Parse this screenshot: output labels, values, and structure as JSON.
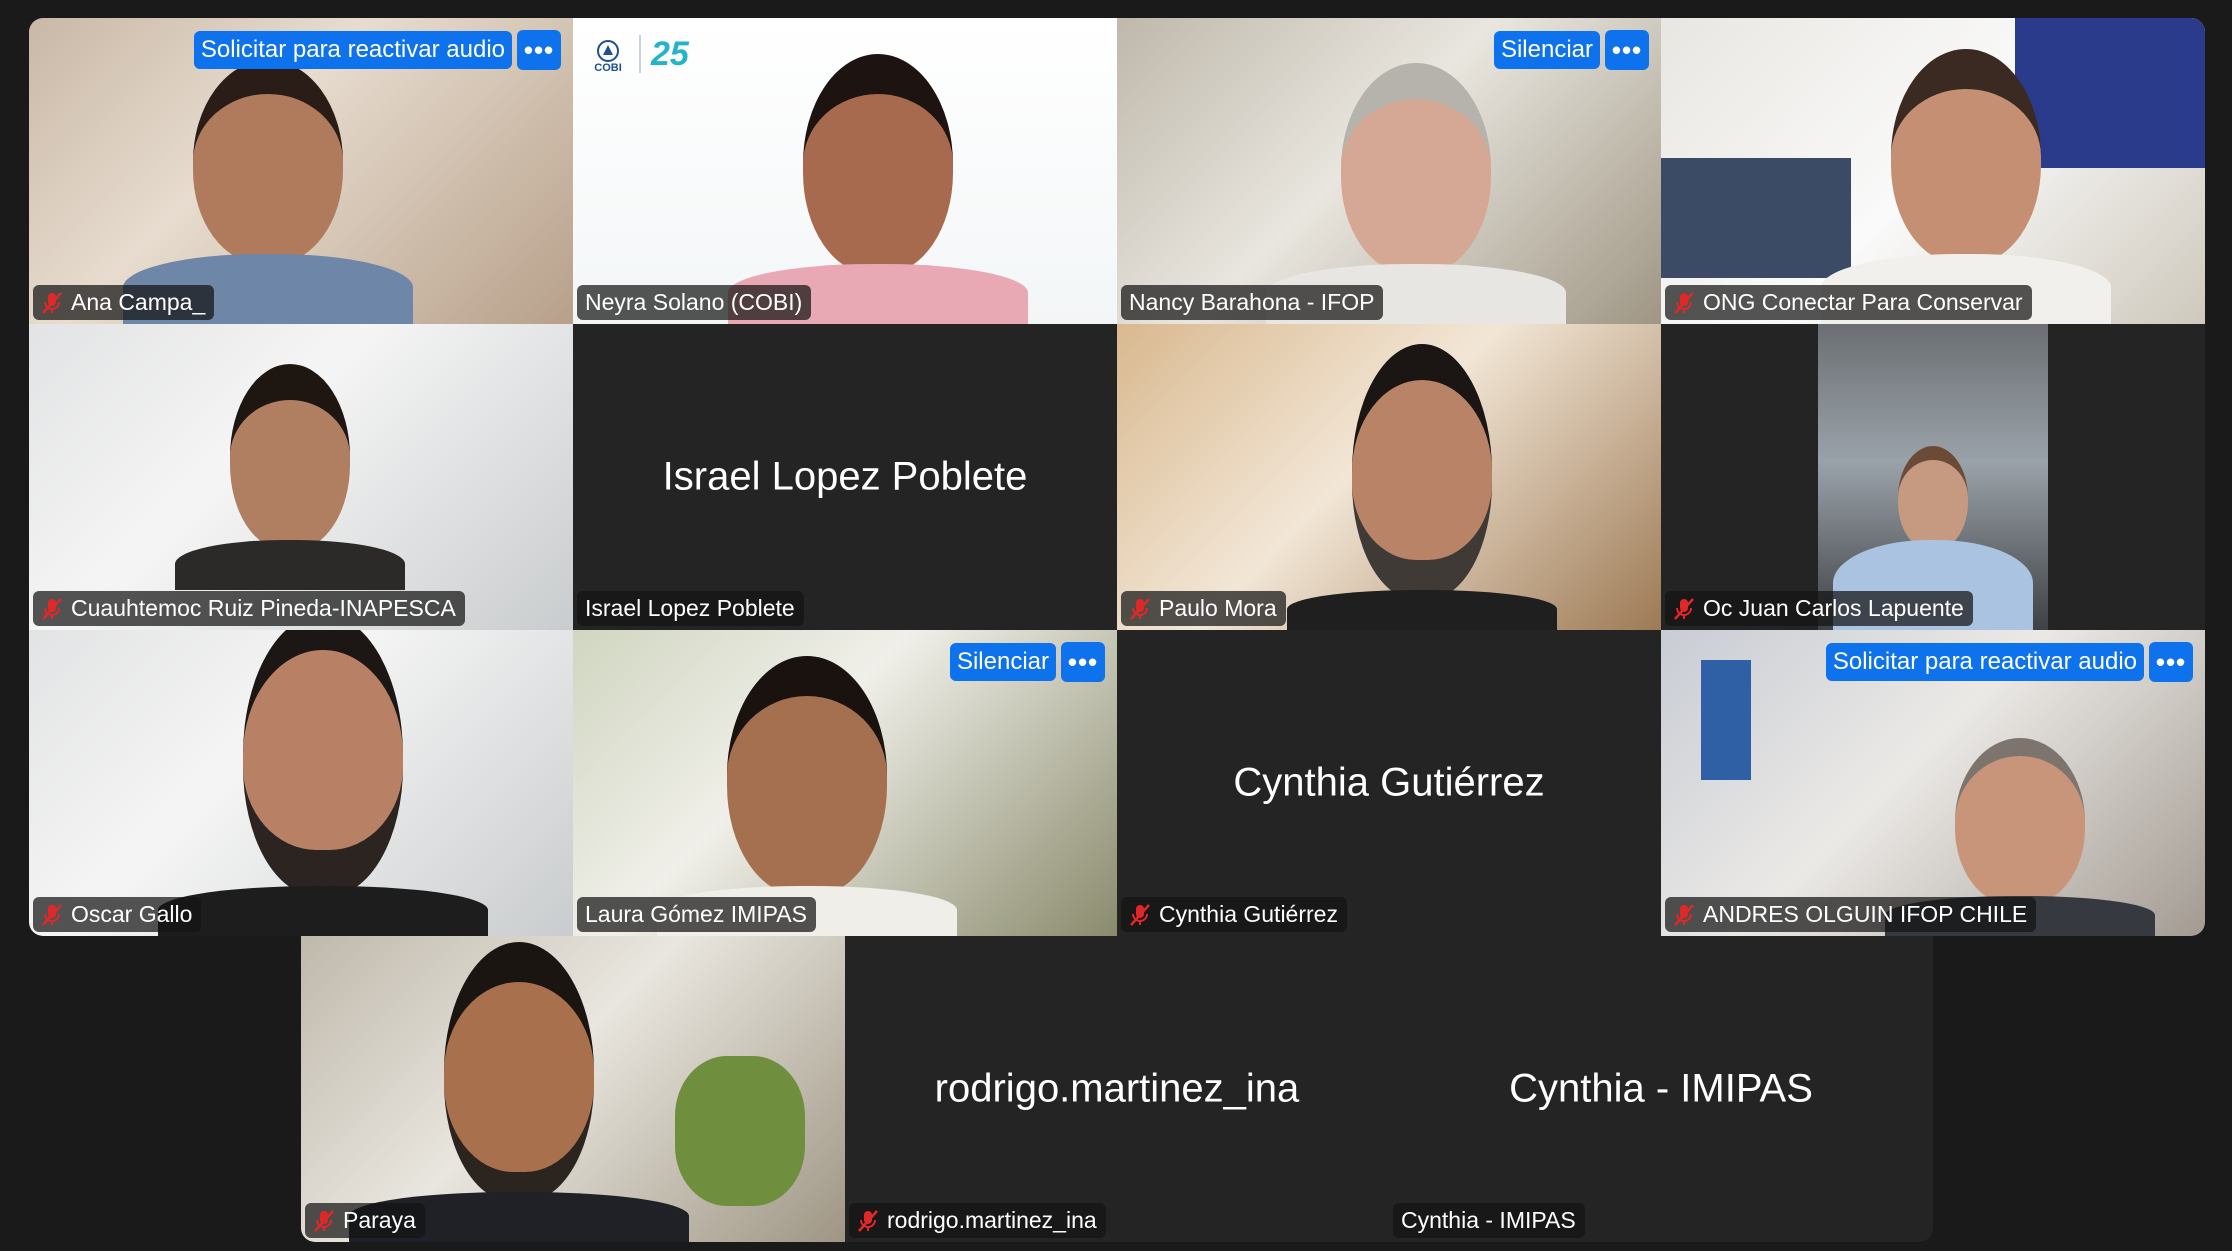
{
  "meeting": {
    "tiles": [
      {
        "name": "Ana Campa_",
        "muted": true,
        "action": "Solicitar para reactivar audio",
        "more": "•••"
      },
      {
        "name": "Neyra Solano (COBI)",
        "muted": false,
        "active_speaker": true,
        "logo_text": "COBI",
        "logo_years": "25"
      },
      {
        "name": "Nancy Barahona - IFOP",
        "muted": false,
        "action": "Silenciar",
        "more": "•••"
      },
      {
        "name": "ONG Conectar Para Conservar",
        "muted": true
      },
      {
        "name": "Cuauhtemoc Ruiz Pineda-INAPESCA",
        "muted": true
      },
      {
        "name": "Israel Lopez Poblete",
        "muted": false,
        "video_off": true,
        "center_name": "Israel Lopez Poblete"
      },
      {
        "name": "Paulo Mora",
        "muted": true
      },
      {
        "name": "Oc Juan Carlos Lapuente",
        "muted": true
      },
      {
        "name": "Oscar Gallo",
        "muted": true
      },
      {
        "name": "Laura Gómez IMIPAS",
        "muted": false,
        "action": "Silenciar",
        "more": "•••"
      },
      {
        "name": "Cynthia Gutiérrez",
        "muted": true,
        "video_off": true,
        "center_name": "Cynthia Gutiérrez"
      },
      {
        "name": "ANDRES OLGUIN IFOP CHILE",
        "muted": true,
        "action": "Solicitar para reactivar audio",
        "more": "•••"
      },
      {
        "name": "Paraya",
        "muted": true
      },
      {
        "name": "rodrigo.martinez_ina",
        "muted": true,
        "video_off": true,
        "center_name": "rodrigo.martinez_ina"
      },
      {
        "name": "Cynthia - IMIPAS",
        "muted": false,
        "video_off": true,
        "center_name": "Cynthia - IMIPAS"
      }
    ]
  },
  "colors": {
    "background": "#1a1a1a",
    "tile_dark": "#242424",
    "action_blue": "#0e72ed",
    "active_border": "#23c552",
    "mute_red": "#e02828"
  },
  "icons": {
    "mute": "microphone-muted-icon",
    "more": "more-options-icon"
  }
}
